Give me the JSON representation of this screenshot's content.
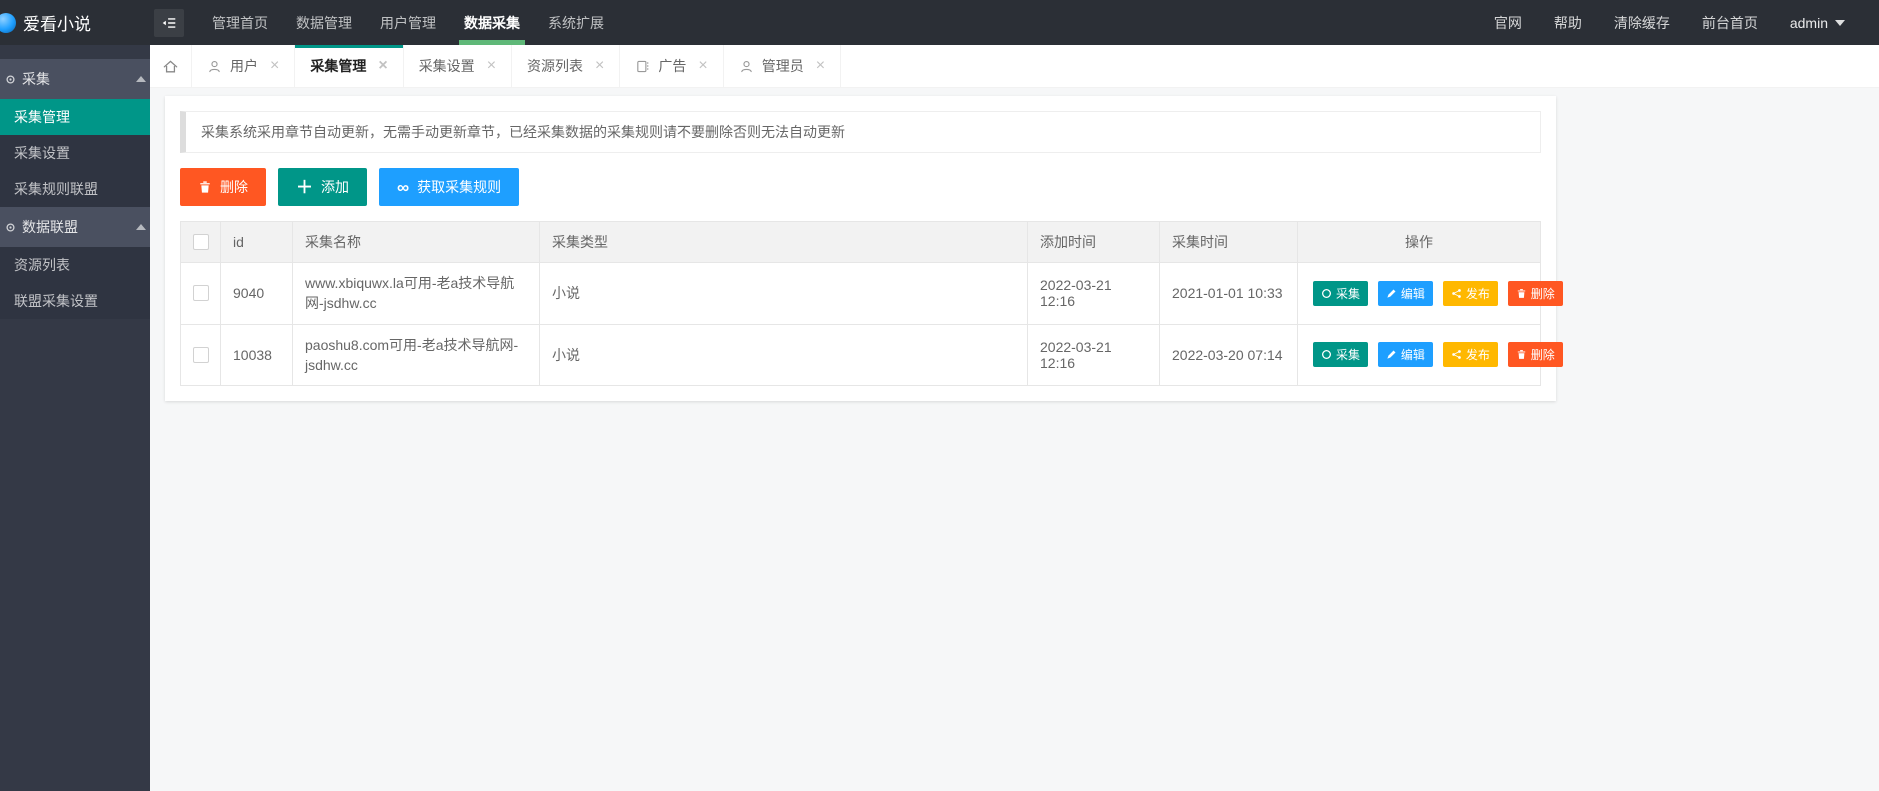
{
  "topbar": {
    "logo": "爱看小说",
    "nav": [
      {
        "label": "管理首页"
      },
      {
        "label": "数据管理"
      },
      {
        "label": "用户管理"
      },
      {
        "label": "数据采集",
        "active": true
      },
      {
        "label": "系统扩展"
      }
    ],
    "links": [
      {
        "label": "官网"
      },
      {
        "label": "帮助"
      },
      {
        "label": "清除缓存"
      },
      {
        "label": "前台首页"
      }
    ],
    "user": "admin"
  },
  "sidebar": {
    "menu": [
      {
        "type": "header",
        "label": "采集"
      },
      {
        "type": "item",
        "label": "采集管理",
        "active": true
      },
      {
        "type": "item",
        "label": "采集设置"
      },
      {
        "type": "item",
        "label": "采集规则联盟"
      },
      {
        "type": "header",
        "label": "数据联盟"
      },
      {
        "type": "item",
        "label": "资源列表"
      },
      {
        "type": "item",
        "label": "联盟采集设置"
      }
    ]
  },
  "tabs": [
    {
      "label": "用户",
      "icon": "user-icon"
    },
    {
      "label": "采集管理",
      "active": true
    },
    {
      "label": "采集设置"
    },
    {
      "label": "资源列表"
    },
    {
      "label": "广告",
      "icon": "ad-icon"
    },
    {
      "label": "管理员",
      "icon": "user-icon"
    }
  ],
  "notice": "采集系统采用章节自动更新，无需手动更新章节，已经采集数据的采集规则请不要删除否则无法自动更新",
  "toolbar": {
    "delete_label": "删除",
    "add_label": "添加",
    "fetch_label": "获取采集规则"
  },
  "table": {
    "columns": {
      "id": "id",
      "name": "采集名称",
      "type": "采集类型",
      "added": "添加时间",
      "collected": "采集时间",
      "ops": "操作"
    },
    "rows": [
      {
        "id": "9040",
        "name": "www.xbiquwx.la可用-老a技术导航网-jsdhw.cc",
        "type": "小说",
        "added": "2022-03-21 12:16",
        "collected": "2021-01-01 10:33"
      },
      {
        "id": "10038",
        "name": "paoshu8.com可用-老a技术导航网-jsdhw.cc",
        "type": "小说",
        "added": "2022-03-21 12:16",
        "collected": "2022-03-20 07:14"
      }
    ],
    "actions": {
      "collect": "采集",
      "edit": "编辑",
      "publish": "发布",
      "del": "删除"
    }
  },
  "colors": {
    "accent_teal": "#009688",
    "accent_green": "#5FB878",
    "blue": "#1E9FFF",
    "red": "#FF5722",
    "yellow": "#FFB800",
    "topbar_bg": "#2B2F36",
    "sidebar_bg": "#343946"
  }
}
